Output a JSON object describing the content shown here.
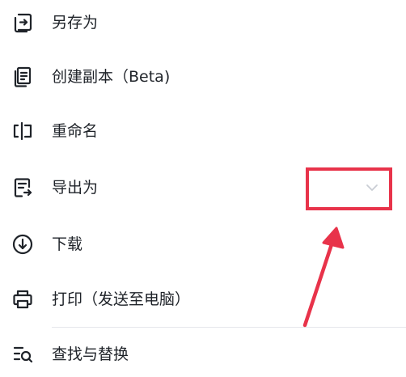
{
  "menu": {
    "items": [
      {
        "label": "另存为",
        "icon": "save-as-icon"
      },
      {
        "label": "创建副本（Beta)",
        "icon": "copy-icon"
      },
      {
        "label": "重命名",
        "icon": "rename-icon"
      },
      {
        "label": "导出为",
        "icon": "export-icon",
        "has_submenu": true
      },
      {
        "label": "下载",
        "icon": "download-icon"
      },
      {
        "label": "打印（发送至电脑）",
        "icon": "print-icon"
      },
      {
        "label": "查找与替换",
        "icon": "find-replace-icon"
      }
    ]
  },
  "annotation": {
    "box_color": "#e8334a",
    "arrow_color": "#e8334a"
  },
  "colors": {
    "text": "#1f2329",
    "icon": "#1f2329",
    "chevron": "#c9cdd4",
    "divider": "#e5e6eb"
  }
}
